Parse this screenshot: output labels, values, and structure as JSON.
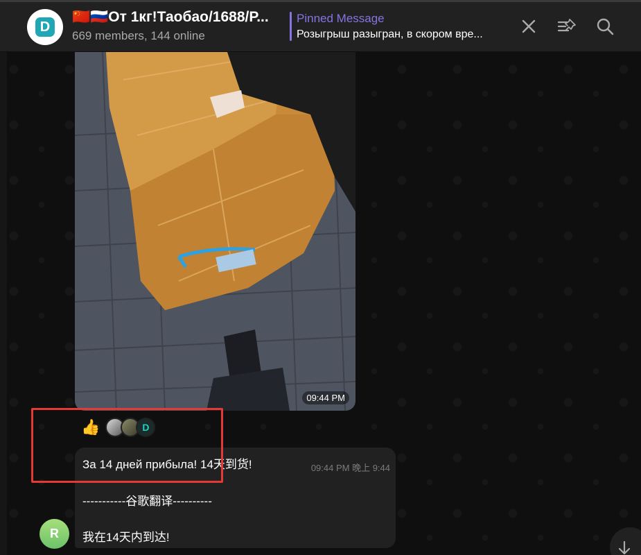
{
  "header": {
    "title": "🇨🇳🇷🇺От 1кг!Таобао/1688/Р...",
    "subtitle": "669 members, 144 online",
    "pinned_label": "Pinned Message",
    "pinned_text": "Розыгрыш разыгран, в скором вре..."
  },
  "photo_message": {
    "time": "09:44 PM"
  },
  "reactions": {
    "emoji": "👍",
    "third_avatar_letter": "D"
  },
  "text_message": {
    "line1": "За 14 дней прибыла! 14天到货!",
    "meta": "09:44 PM 晚上 9:44",
    "line2": "-----------谷歌翻译----------",
    "line3": "我在14天内到达!",
    "sender_initial": "R"
  },
  "icons": {
    "close": "close-icon",
    "pinned_list": "pinned-list-icon",
    "search": "search-icon",
    "scroll_down": "arrow-down-icon"
  },
  "colors": {
    "accent": "#8774e1",
    "highlight": "#e53935",
    "avatar_brand": "#1fa7b5"
  }
}
